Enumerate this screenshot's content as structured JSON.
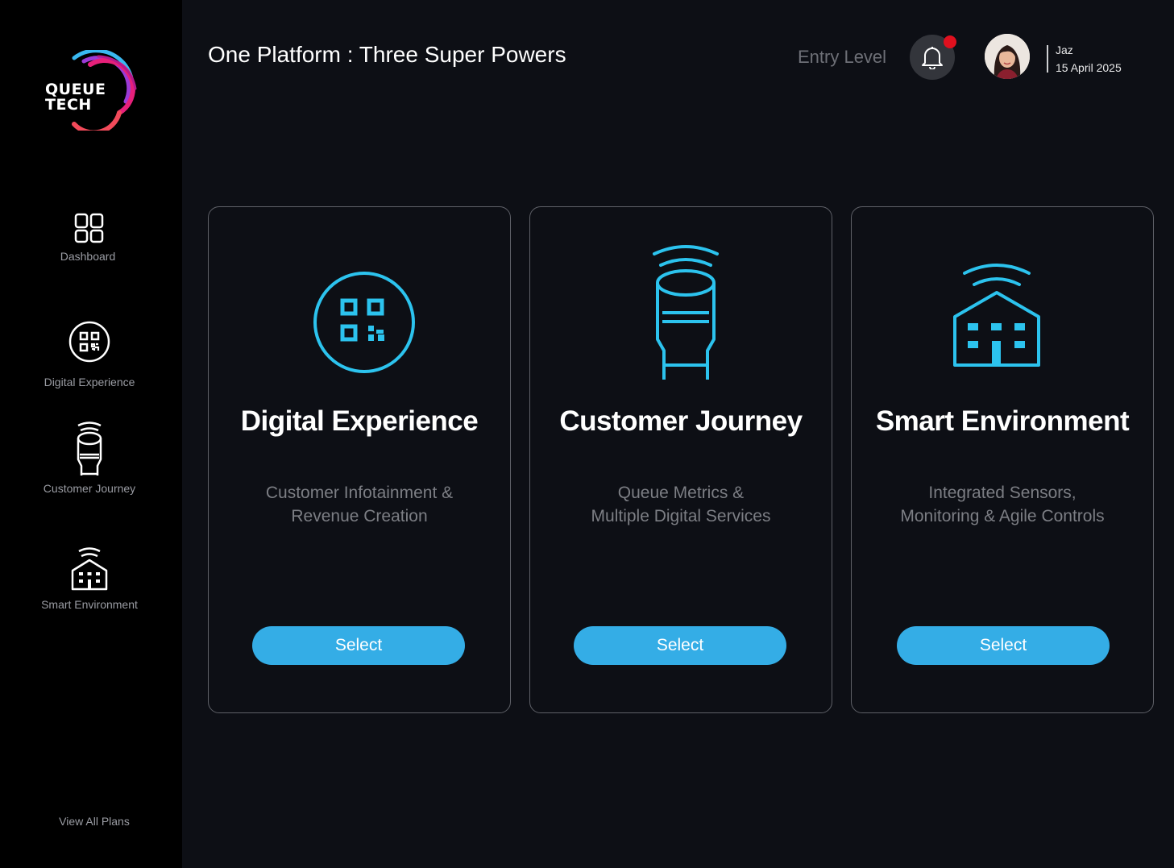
{
  "brand": {
    "logo_line1": "QUEUE",
    "logo_line2": "TECH",
    "accent_colors": [
      "#3ab8f0",
      "#e6207a",
      "#9b3ad6",
      "#f24a5a"
    ]
  },
  "sidebar": {
    "items": [
      {
        "label": "Dashboard",
        "icon": "dashboard-grid-icon"
      },
      {
        "label": "Digital Experience",
        "icon": "qr-code-icon"
      },
      {
        "label": "Customer Journey",
        "icon": "kiosk-icon"
      },
      {
        "label": "Smart Environment",
        "icon": "smart-building-icon"
      }
    ],
    "footer_link": "View All Plans"
  },
  "header": {
    "title": "One Platform : Three Super Powers",
    "level": "Entry Level",
    "notification_icon": "bell-icon",
    "has_notification": true,
    "user": {
      "name": "Jaz",
      "date": "15 April 2025"
    }
  },
  "cards": [
    {
      "title": "Digital Experience",
      "desc_line1": "Customer Infotainment &",
      "desc_line2": "Revenue Creation",
      "button": "Select",
      "icon": "qr-code-icon"
    },
    {
      "title": "Customer Journey",
      "desc_line1": "Queue Metrics &",
      "desc_line2": "Multiple Digital Services",
      "button": "Select",
      "icon": "kiosk-icon"
    },
    {
      "title": "Smart Environment",
      "desc_line1": "Integrated Sensors,",
      "desc_line2": "Monitoring & Agile Controls",
      "button": "Select",
      "icon": "smart-building-icon"
    }
  ],
  "colors": {
    "background": "#0d0f15",
    "sidebar": "#000000",
    "accent": "#34ade6",
    "icon_cyan": "#2cc3ee",
    "notification_dot": "#e0101e"
  }
}
